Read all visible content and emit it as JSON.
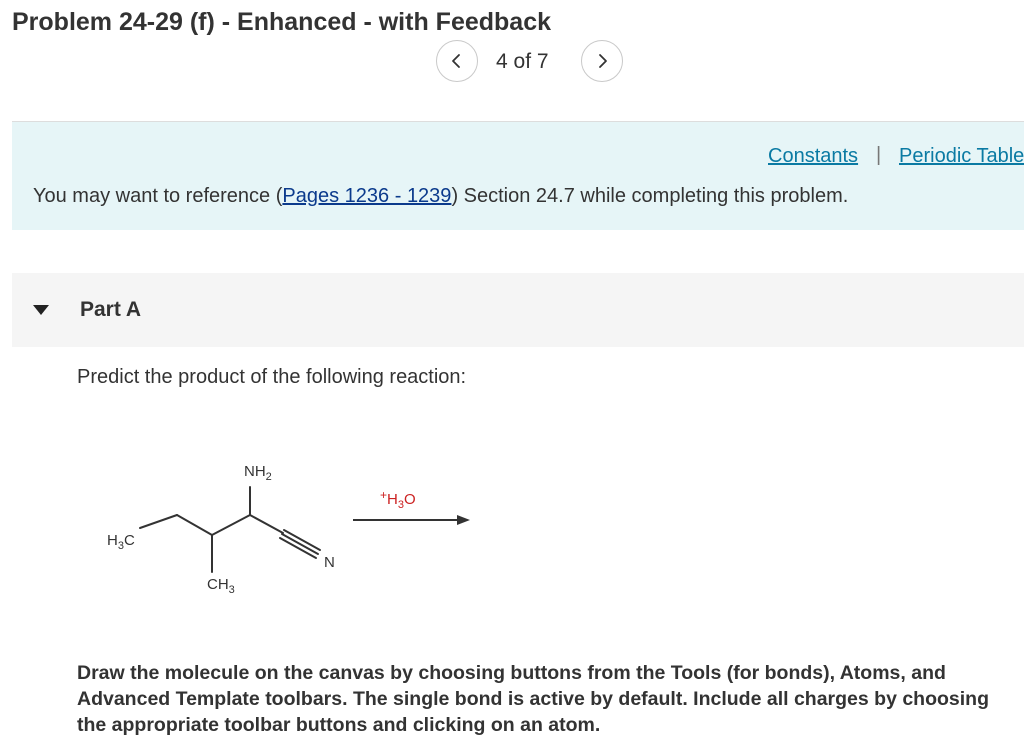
{
  "header": {
    "title": "Problem 24-29 (f) - Enhanced - with Feedback",
    "pagination": {
      "text": "4 of 7"
    }
  },
  "info": {
    "constants_link": "Constants",
    "separator": "|",
    "periodic_table_link": "Periodic Table",
    "reference_prefix": "You may want to reference (",
    "reference_link": "Pages 1236 - 1239",
    "reference_suffix": ") Section 24.7 while completing this problem."
  },
  "part": {
    "label": "Part A",
    "question": "Predict the product of the following reaction:",
    "instructions": "Draw the molecule on the canvas by choosing buttons from the Tools (for bonds), Atoms, and Advanced Template toolbars. The single bond is active by default. Include all charges by choosing the appropriate toolbar buttons and clicking on an atom."
  },
  "reaction": {
    "reactant_labels": {
      "nh2_main": "NH",
      "nh2_sub": "2",
      "h3c_main": "H",
      "h3c_sub": "3",
      "h3c_end": "C",
      "ch3_main": "CH",
      "ch3_sub": "3",
      "nitrogen": "N"
    },
    "reagent": {
      "plus": "+",
      "h_main": "H",
      "h_sub": "3",
      "o": "O"
    }
  },
  "colors": {
    "info_background": "#e6f5f7",
    "part_background": "#f5f5f5",
    "link": "#0a7aa3",
    "reference_link": "#0b3a8c",
    "reagent_red": "#cc2222"
  }
}
